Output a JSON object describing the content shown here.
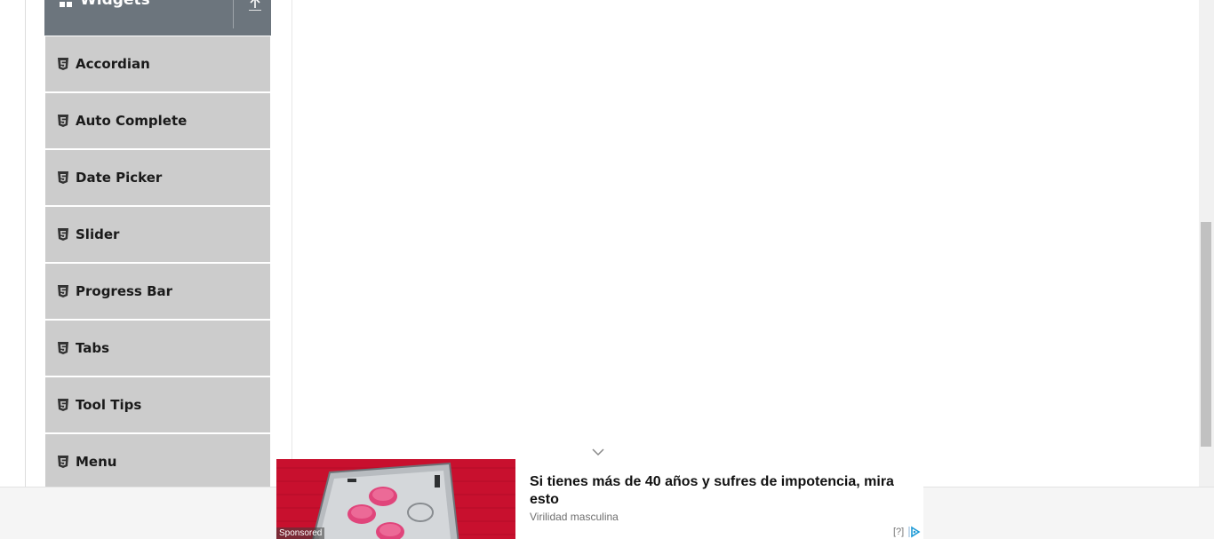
{
  "sidebar": {
    "group": {
      "title": "Widgets",
      "icon": "widgets-grid-icon",
      "toggle_icon": "collapse-up-icon"
    },
    "items": [
      {
        "label": "Accordian",
        "icon": "html5-icon"
      },
      {
        "label": "Auto Complete",
        "icon": "html5-icon"
      },
      {
        "label": "Date Picker",
        "icon": "html5-icon"
      },
      {
        "label": "Slider",
        "icon": "html5-icon"
      },
      {
        "label": "Progress Bar",
        "icon": "html5-icon"
      },
      {
        "label": "Tabs",
        "icon": "html5-icon"
      },
      {
        "label": "Tool Tips",
        "icon": "html5-icon"
      },
      {
        "label": "Menu",
        "icon": "html5-icon"
      }
    ]
  },
  "ad": {
    "headline": "Si tienes más de 40 años y sufres de impotencia, mira esto",
    "source": "Virilidad masculina",
    "sponsored_label": "Sponsored",
    "help_label": "[?]",
    "collapse_icon": "chevron-down-icon",
    "choices_icon": "adchoices-icon"
  },
  "colors": {
    "group_header_bg": "#6c757d",
    "menu_item_bg": "#cccccc",
    "ad_image_bg": "#c8102e",
    "pill_color": "#e0457b"
  }
}
